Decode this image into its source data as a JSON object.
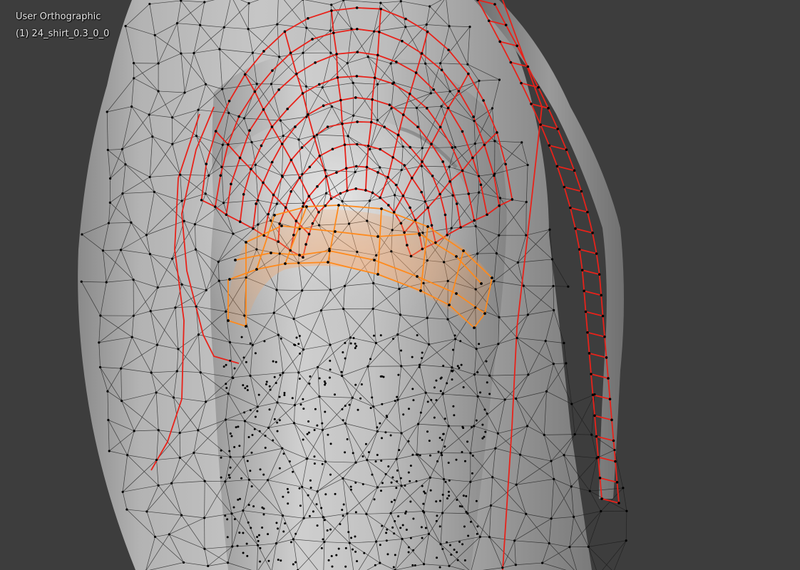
{
  "viewport": {
    "view_name": "User Orthographic",
    "object_name": "(1) 24_shirt_0.3_0_0"
  },
  "colors": {
    "background": "#3d3d3d",
    "mesh_wire": "#1a1a1a",
    "selected_edge": "#e8221a",
    "active_face": "#ff8a1c",
    "vertex": "#000000"
  }
}
